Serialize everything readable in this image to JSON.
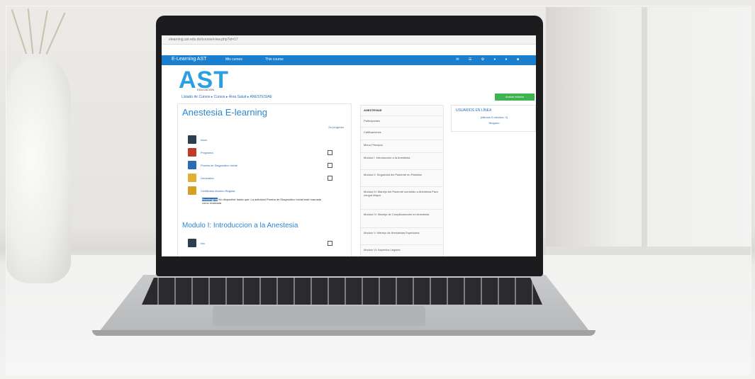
{
  "scene": {
    "description": "laptop on desk showing e-learning page"
  },
  "browser": {
    "url": "elearning.ast.edu.do/course/view.php?id=17"
  },
  "site": {
    "brand": "E-Learning AST",
    "menu_my_courses": "Mis cursos",
    "menu_this_course": "This course",
    "logo_text": "AST",
    "logo_subtitle": "EDUCACIÓN",
    "breadcrumb": "Listado de Cursos  ▸  Cursos  ▸  Área Salud  ▸  ANESTESIAE",
    "activate_edit": "Activar edición"
  },
  "course": {
    "title": "Anestesia E-learning",
    "progress_label": "Su progreso",
    "activities": [
      {
        "label": "Inicio"
      },
      {
        "label": "Programa"
      },
      {
        "label": "Prueba de Diagnostico Inicial"
      },
      {
        "label": "Generales"
      },
      {
        "label": "Certificado Alumno Regular"
      }
    ],
    "restriction_note_prefix": "Restringido",
    "restriction_note": "No disponible hasta que: La actividad Prueba de Diagnostico Inicial esté marcada como realizada",
    "section_title": "Modulo I: Introduccion a la Anestesia",
    "section_item": "Inic"
  },
  "sidebar": {
    "header": "ANESTESIAE",
    "items": [
      "Participantes",
      "Calificaciones",
      "Menú Principal",
      "Modulo I: Introduccion a la Anestesia",
      "Modulo II: Seguridad del Paciente en Pabellon",
      "Modulo III: Manejo del Paciente sometido a Anestesia Para cirugía Mayor",
      "Modulo IV: Manejo de Complicaciones en Anestesia",
      "Modulo V: Manejo de Anestesias Especiales",
      "Modulo VI: Aspectos Legales"
    ]
  },
  "online_users": {
    "title": "USUARIOS EN LÍNEA",
    "subtitle": "(últimos 5 minutos: 0)",
    "none": "Ninguno"
  },
  "colors": {
    "nav_blue": "#1b7fce",
    "logo_blue": "#2b9fe0",
    "activate_green": "#3fb34f"
  }
}
